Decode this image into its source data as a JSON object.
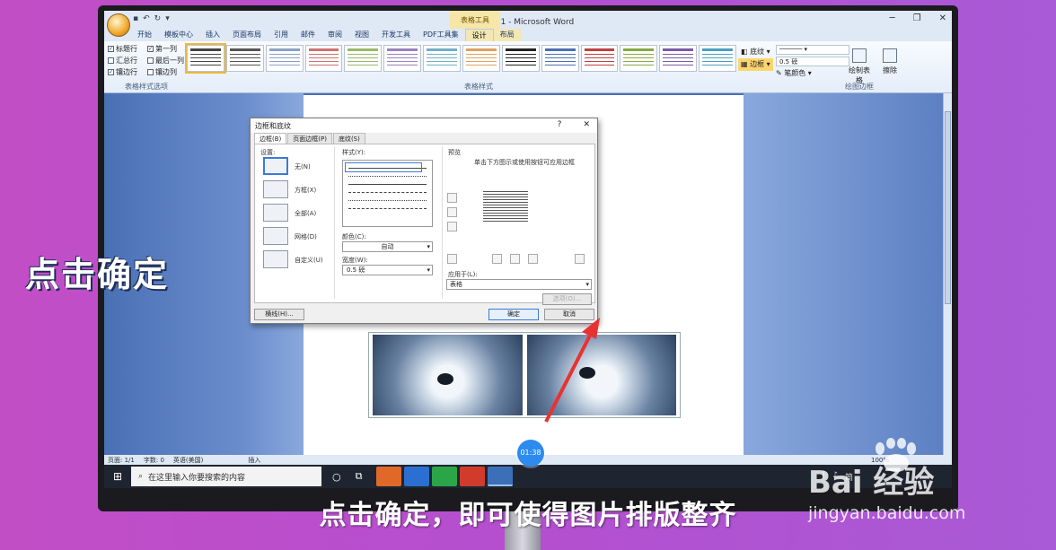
{
  "window": {
    "title": "文档 1 - Microsoft Word",
    "context_tool": "表格工具"
  },
  "tabs": [
    "开始",
    "模板中心",
    "插入",
    "页面布局",
    "引用",
    "邮件",
    "审阅",
    "视图",
    "开发工具",
    "PDF工具集",
    "设计",
    "布局"
  ],
  "active_tab": "设计",
  "ribbon": {
    "style_options": [
      "标题行",
      "第一列",
      "汇总行",
      "最后一列",
      "镶边行",
      "镶边列"
    ],
    "style_options_checked": [
      true,
      true,
      false,
      false,
      true,
      false
    ],
    "group_style_options": "表格样式选项",
    "group_styles": "表格样式",
    "group_draw": "绘图边框",
    "shading_label": "底纹",
    "borders_label": "边框",
    "weight_value": "0.5 磅",
    "pen_color_label": "笔颜色",
    "draw_table_label": "绘制表格",
    "eraser_label": "擦除",
    "swatch_colors": [
      "#444444",
      "#555555",
      "#8aa0c8",
      "#d07070",
      "#9ab86a",
      "#9a80c0",
      "#70b0c8",
      "#e0a060",
      "#222222",
      "#4a70b5",
      "#c04040",
      "#88aa44",
      "#7a5aa8",
      "#4aa0c0"
    ]
  },
  "headline": "点击确定",
  "dialog": {
    "title": "边框和底纹",
    "help": "?",
    "close": "✕",
    "tabs": [
      "边框(B)",
      "页面边框(P)",
      "底纹(S)"
    ],
    "setting_label": "设置:",
    "settings": [
      "无(N)",
      "方框(X)",
      "全部(A)",
      "网格(D)",
      "自定义(U)"
    ],
    "style_label": "样式(Y):",
    "color_label": "颜色(C):",
    "color_value": "自动",
    "width_label": "宽度(W):",
    "width_value": "0.5 磅",
    "preview_label": "预览",
    "preview_hint": "单击下方图示或使用按钮可应用边框",
    "apply_label": "应用于(L):",
    "apply_value": "表格",
    "options_button": "选项(O)...",
    "horizontal_button": "横线(H)...",
    "ok_button": "确定",
    "cancel_button": "取消"
  },
  "statusbar": {
    "page": "页面: 1/1",
    "words": "字数: 0",
    "lang": "英语(美国)",
    "mode": "插入",
    "zoom": "100%"
  },
  "taskbar": {
    "search_placeholder": "在这里输入你要搜索的内容",
    "tray_lang": "简"
  },
  "video": {
    "timestamp": "01:38"
  },
  "caption": "点击确定，即可使得图片排版整齐",
  "watermark": {
    "logo": "Bai 经验",
    "url": "jingyan.baidu.com"
  }
}
